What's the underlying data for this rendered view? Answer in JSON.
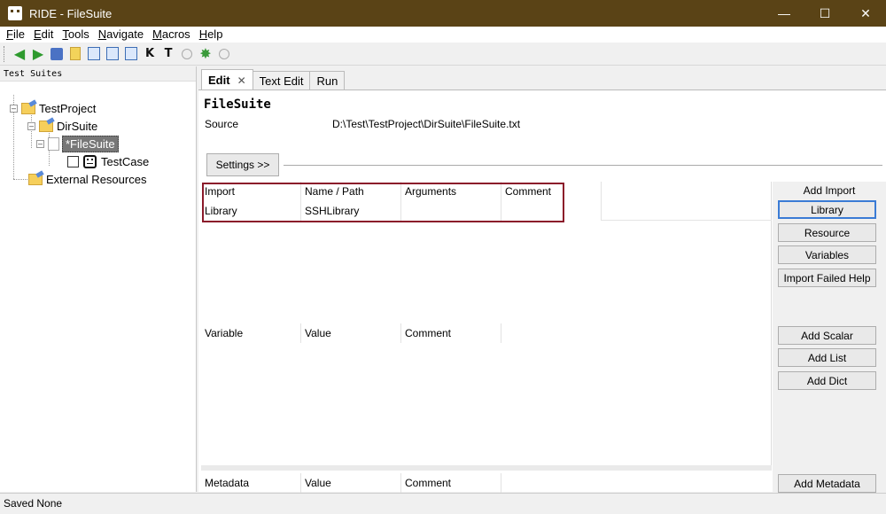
{
  "window": {
    "title": "RIDE - FileSuite"
  },
  "menu": [
    {
      "label": "File",
      "key": "F"
    },
    {
      "label": "Edit",
      "key": "E"
    },
    {
      "label": "Tools",
      "key": "T"
    },
    {
      "label": "Navigate",
      "key": "N"
    },
    {
      "label": "Macros",
      "key": "M"
    },
    {
      "label": "Help",
      "key": "H"
    }
  ],
  "toolbar": {
    "k_label": "K",
    "t_label": "T"
  },
  "tree": {
    "header": "Test Suites",
    "project": "TestProject",
    "dir_suite": "DirSuite",
    "file_suite": "*FileSuite",
    "test_case": "TestCase",
    "external": "External Resources"
  },
  "tabs": [
    {
      "label": "Edit",
      "active": true
    },
    {
      "label": "Text Edit",
      "active": false
    },
    {
      "label": "Run",
      "active": false
    }
  ],
  "editor": {
    "suite_name": "FileSuite",
    "source_label": "Source",
    "source_value": "D:\\Test\\TestProject\\DirSuite\\FileSuite.txt",
    "settings_label": "Settings >>"
  },
  "imports": {
    "headers": [
      "Import",
      "Name / Path",
      "Arguments",
      "Comment"
    ],
    "rows": [
      [
        "Library",
        "SSHLibrary",
        "",
        ""
      ]
    ]
  },
  "variables": {
    "headers": [
      "Variable",
      "Value",
      "Comment"
    ]
  },
  "metadata": {
    "headers": [
      "Metadata",
      "Value",
      "Comment"
    ]
  },
  "side_buttons": {
    "add_import_label": "Add Import",
    "library": "Library",
    "resource": "Resource",
    "variables": "Variables",
    "import_failed_help": "Import Failed Help",
    "add_scalar": "Add Scalar",
    "add_list": "Add List",
    "add_dict": "Add Dict",
    "add_metadata": "Add Metadata"
  },
  "status": {
    "text": "Saved None"
  }
}
